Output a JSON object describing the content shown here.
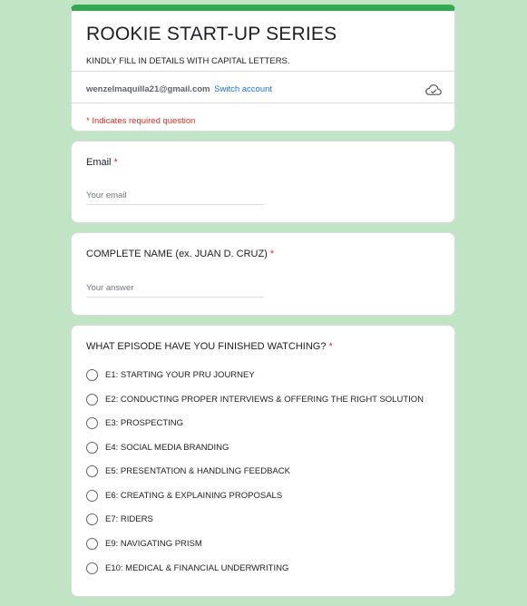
{
  "header": {
    "title": "ROOKIE START-UP SERIES",
    "description": "KINDLY FILL IN DETAILS WITH CAPITAL LETTERS.",
    "account_email": "wenzelmaquilla21@gmail.com",
    "switch_account": "Switch account",
    "required_note": "* Indicates required question",
    "cloud_icon": "cloud-saved-icon"
  },
  "email_question": {
    "label": "Email",
    "required_mark": "*",
    "placeholder": "Your email",
    "value": ""
  },
  "name_question": {
    "label": "COMPLETE NAME (ex. JUAN D. CRUZ)",
    "required_mark": "*",
    "placeholder": "Your answer",
    "value": ""
  },
  "episode_question": {
    "label": "WHAT EPISODE HAVE YOU FINISHED WATCHING?",
    "required_mark": "*",
    "options": [
      "E1: STARTING YOUR PRU JOURNEY",
      "E2: CONDUCTING PROPER INTERVIEWS & OFFERING THE RIGHT SOLUTION",
      "E3: PROSPECTING",
      "E4: SOCIAL MEDIA BRANDING",
      "E5: PRESENTATION & HANDLING FEEDBACK",
      "E6: CREATING & EXPLAINING PROPOSALS",
      "E7: RIDERS",
      "E9: NAVIGATING PRISM",
      "E10: MEDICAL & FINANCIAL UNDERWRITING"
    ]
  },
  "colors": {
    "background": "#c0e4c4",
    "accent": "#34a853",
    "required": "#d93025",
    "link": "#1a73e8"
  }
}
